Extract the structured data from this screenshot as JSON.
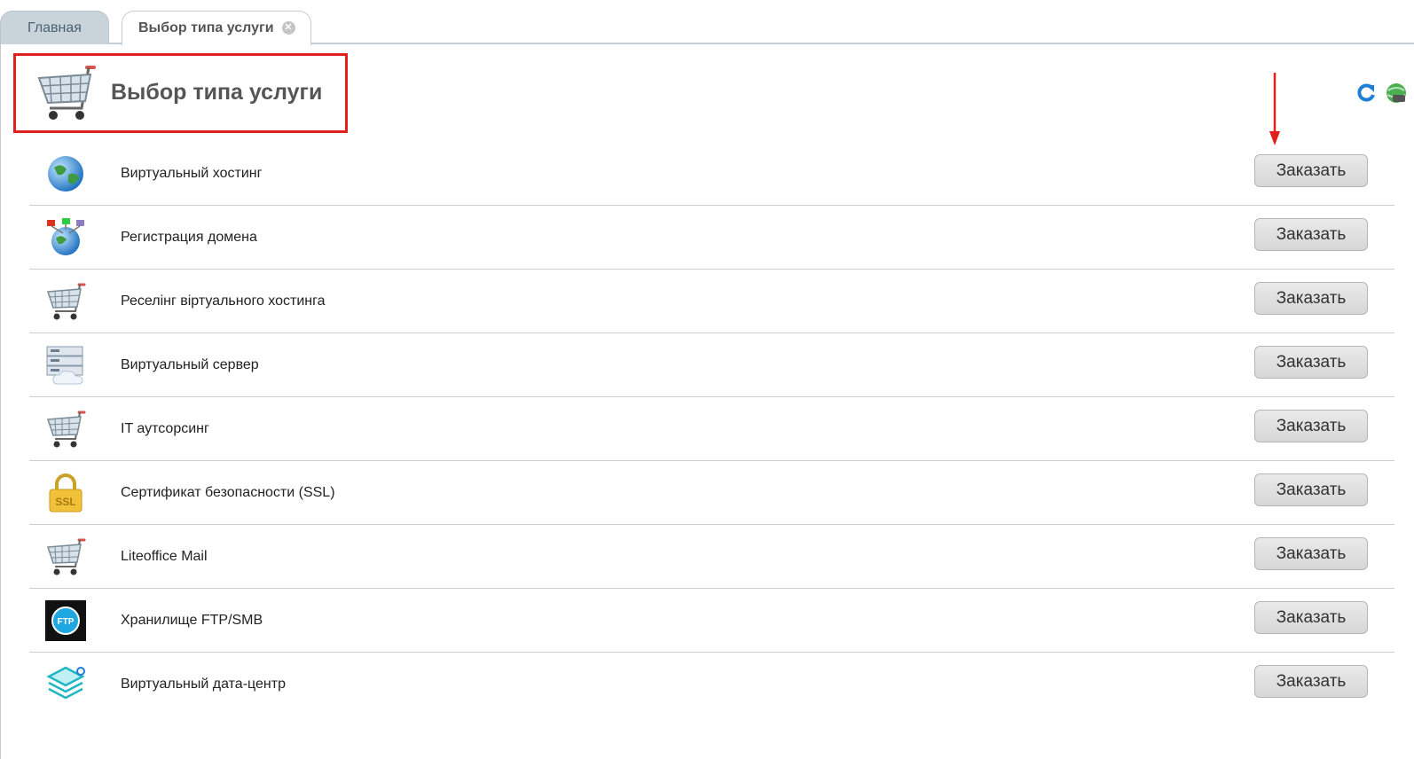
{
  "tabs": {
    "home": "Главная",
    "active": "Выбор типа услуги",
    "close_glyph": "✕"
  },
  "header": {
    "title": "Выбор типа услуги",
    "icon": "shopping-cart-icon"
  },
  "toolbar": {
    "refresh_icon": "refresh-icon",
    "globe_icon": "globe-icon"
  },
  "colors": {
    "highlight": "#e0201b",
    "tab_home_bg": "#c9d3da"
  },
  "services": [
    {
      "name": "Виртуальный хостинг",
      "icon": "globe-icon",
      "button": "Заказать"
    },
    {
      "name": "Регистрация домена",
      "icon": "domain-globe-icon",
      "button": "Заказать"
    },
    {
      "name": "Реселінг віртуального хостинга",
      "icon": "shopping-cart-icon",
      "button": "Заказать"
    },
    {
      "name": "Виртуальный сервер",
      "icon": "server-cloud-icon",
      "button": "Заказать"
    },
    {
      "name": "IT аутсорсинг",
      "icon": "shopping-cart-icon",
      "button": "Заказать"
    },
    {
      "name": "Сертификат безопасности (SSL)",
      "icon": "ssl-lock-icon",
      "button": "Заказать"
    },
    {
      "name": "Liteoffice Mail",
      "icon": "shopping-cart-icon",
      "button": "Заказать"
    },
    {
      "name": "Хранилище FTP/SMB",
      "icon": "ftp-cloud-icon",
      "button": "Заказать"
    },
    {
      "name": "Виртуальный дата-центр",
      "icon": "datacenter-layers-icon",
      "button": "Заказать"
    }
  ]
}
